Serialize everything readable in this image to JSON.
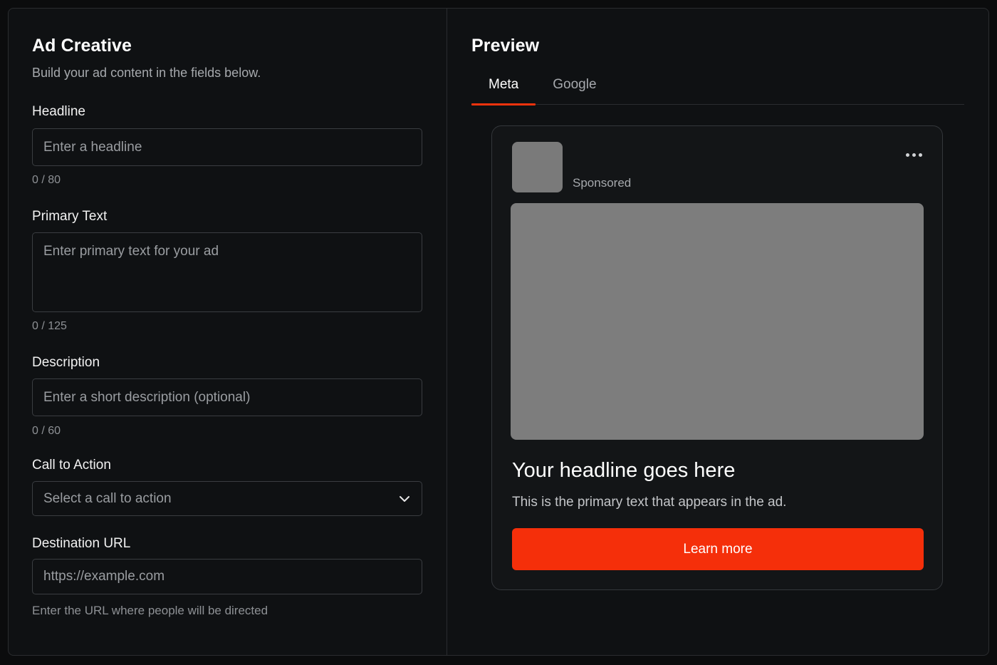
{
  "form": {
    "title": "Ad Creative",
    "subtitle": "Build your ad content in the fields below.",
    "headline": {
      "label": "Headline",
      "placeholder": "Enter a headline",
      "counter": "0 / 80"
    },
    "primary_text": {
      "label": "Primary Text",
      "placeholder": "Enter primary text for your ad",
      "counter": "0 / 125"
    },
    "description": {
      "label": "Description",
      "placeholder": "Enter a short description (optional)",
      "counter": "0 / 60"
    },
    "call_to_action": {
      "label": "Call to Action",
      "placeholder": "Select a call to action",
      "icon": "chevron-down-icon"
    },
    "destination_url": {
      "label": "Destination URL",
      "placeholder": "https://example.com",
      "helper": "Enter the URL where people will be directed"
    }
  },
  "preview": {
    "title": "Preview",
    "tabs": [
      {
        "label": "Meta",
        "active": true
      },
      {
        "label": "Google",
        "active": false
      }
    ],
    "ad": {
      "sponsored": "Sponsored",
      "menu_icon": "more-horizontal-icon",
      "headline": "Your headline goes here",
      "primary_text": "This is the primary text that appears in the ad.",
      "cta_label": "Learn more"
    }
  },
  "colors": {
    "accent": "#f52f0a",
    "background": "#0f1113",
    "border": "#2a2c2f"
  }
}
